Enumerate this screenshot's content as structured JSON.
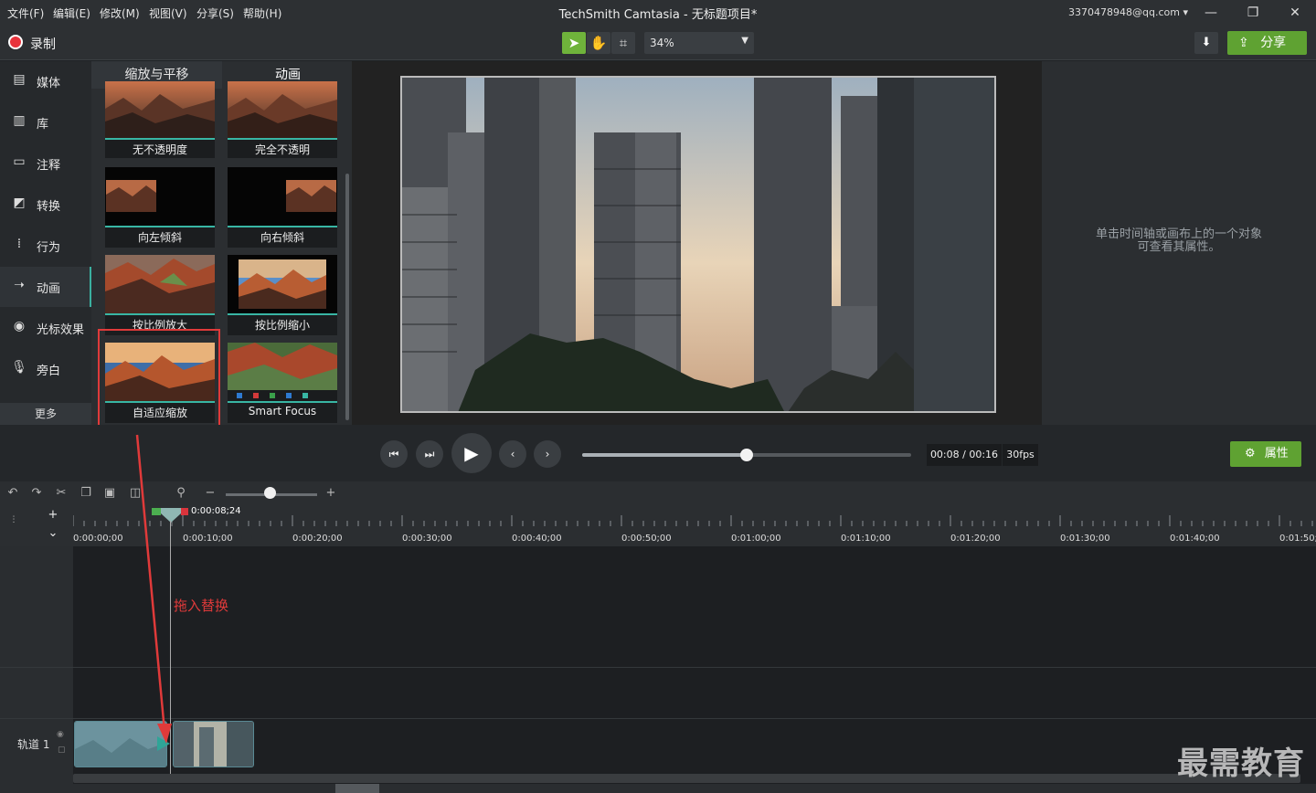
{
  "menu": [
    "文件(F)",
    "编辑(E)",
    "修改(M)",
    "视图(V)",
    "分享(S)",
    "帮助(H)"
  ],
  "app_title": "TechSmith Camtasia - 无标题项目*",
  "account": "3370478948@qq.com",
  "toolbar": {
    "record_label": "录制",
    "zoom_value": "34%",
    "share_label": "分享"
  },
  "leftnav": {
    "items": [
      {
        "label": "媒体",
        "icon": "film-icon"
      },
      {
        "label": "库",
        "icon": "library-icon"
      },
      {
        "label": "注释",
        "icon": "annotation-icon"
      },
      {
        "label": "转换",
        "icon": "transition-icon"
      },
      {
        "label": "行为",
        "icon": "behavior-icon"
      },
      {
        "label": "动画",
        "icon": "animation-icon"
      },
      {
        "label": "光标效果",
        "icon": "cursor-icon"
      },
      {
        "label": "旁白",
        "icon": "microphone-icon"
      }
    ],
    "more_label": "更多"
  },
  "library": {
    "tabs": [
      "缩放与平移",
      "动画"
    ],
    "tiles": [
      {
        "label": "无不透明度"
      },
      {
        "label": "完全不透明"
      },
      {
        "label": "向左倾斜"
      },
      {
        "label": "向右倾斜"
      },
      {
        "label": "按比例放大"
      },
      {
        "label": "按比例缩小"
      },
      {
        "label": "自适应缩放"
      },
      {
        "label": "Smart Focus"
      }
    ]
  },
  "properties": {
    "hint_line1": "单击时间轴或画布上的一个对象",
    "hint_line2": "可查看其属性。",
    "button_label": "属性"
  },
  "playback": {
    "timecode": "00:08 / 00:16",
    "fps": "30fps",
    "progress": 0.5
  },
  "timeline": {
    "playhead_time": "0:00:08;24",
    "ruler_labels": [
      "0:00:00;00",
      "0:00:10;00",
      "0:00:20;00",
      "0:00:30;00",
      "0:00:40;00",
      "0:00:50;00",
      "0:01:00;00",
      "0:01:10;00",
      "0:01:20;00",
      "0:01:30;00",
      "0:01:40;00",
      "0:01:50;"
    ],
    "track_label": "轨道 1",
    "drag_hint": "拖入替换"
  },
  "watermark": "最需教育",
  "colors": {
    "accent_green": "#5fa232",
    "teal": "#38b6a4",
    "record_red": "#e8333c",
    "highlight_red": "#e03a3a"
  }
}
